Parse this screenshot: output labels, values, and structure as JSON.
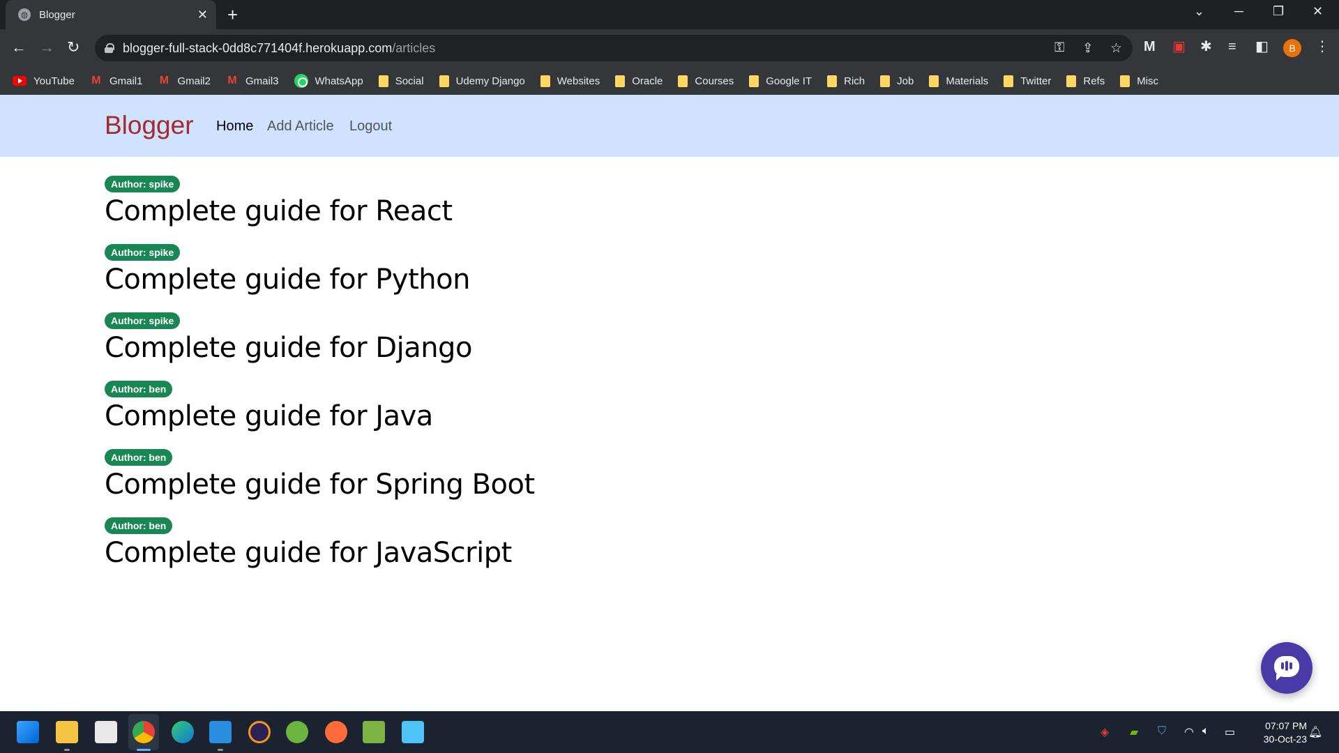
{
  "browser": {
    "tab_title": "Blogger",
    "url_host": "blogger-full-stack-0dd8c771404f.herokuapp.com",
    "url_path": "/articles",
    "profile_initial": "B",
    "bookmarks": [
      {
        "label": "YouTube",
        "icon": "youtube-icon"
      },
      {
        "label": "Gmail1",
        "icon": "gmail-icon"
      },
      {
        "label": "Gmail2",
        "icon": "gmail-icon"
      },
      {
        "label": "Gmail3",
        "icon": "gmail-icon"
      },
      {
        "label": "WhatsApp",
        "icon": "whatsapp-icon"
      },
      {
        "label": "Social",
        "icon": "folder-icon"
      },
      {
        "label": "Udemy Django",
        "icon": "folder-icon"
      },
      {
        "label": "Websites",
        "icon": "folder-icon"
      },
      {
        "label": "Oracle",
        "icon": "folder-icon"
      },
      {
        "label": "Courses",
        "icon": "folder-icon"
      },
      {
        "label": "Google IT",
        "icon": "folder-icon"
      },
      {
        "label": "Rich",
        "icon": "folder-icon"
      },
      {
        "label": "Job",
        "icon": "folder-icon"
      },
      {
        "label": "Materials",
        "icon": "folder-icon"
      },
      {
        "label": "Twitter",
        "icon": "folder-icon"
      },
      {
        "label": "Refs",
        "icon": "folder-icon"
      },
      {
        "label": "Misc",
        "icon": "folder-icon"
      }
    ]
  },
  "navbar": {
    "brand": "Blogger",
    "home": "Home",
    "add_article": "Add Article",
    "logout": "Logout"
  },
  "articles": [
    {
      "author": "Author: spike",
      "title": "Complete guide for React"
    },
    {
      "author": "Author: spike",
      "title": "Complete guide for Python"
    },
    {
      "author": "Author: spike",
      "title": "Complete guide for Django"
    },
    {
      "author": "Author: ben",
      "title": "Complete guide for Java"
    },
    {
      "author": "Author: ben",
      "title": "Complete guide for Spring Boot"
    },
    {
      "author": "Author: ben",
      "title": "Complete guide for JavaScript"
    }
  ],
  "taskbar": {
    "time": "07:07 PM",
    "date": "30-Oct-23"
  },
  "colors": {
    "navbar_bg": "#cfe2ff",
    "brand": "#a52a2a",
    "badge": "#198754",
    "chat_fab": "#4a3aa8"
  }
}
